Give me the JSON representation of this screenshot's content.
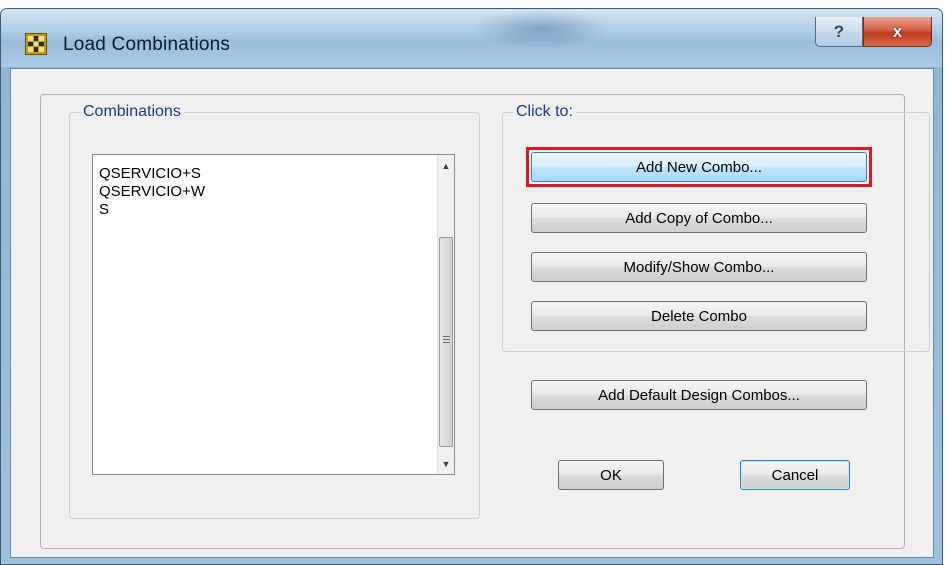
{
  "window": {
    "title": "Load Combinations",
    "help_glyph": "?",
    "close_glyph": "x",
    "icon": "sap-app-icon"
  },
  "combinations": {
    "label": "Combinations",
    "items": [
      "QSERVICIO+S",
      "QSERVICIO+W",
      "S"
    ],
    "scroll_up_glyph": "▲",
    "scroll_down_glyph": "▼"
  },
  "click_to": {
    "label": "Click to:",
    "add_new": "Add New Combo...",
    "add_copy": "Add Copy of Combo...",
    "modify": "Modify/Show Combo...",
    "delete": "Delete Combo"
  },
  "add_default": "Add Default Design Combos...",
  "ok": "OK",
  "cancel": "Cancel",
  "colors": {
    "highlight": "#e0171d",
    "group_label": "#1c3a8c"
  }
}
